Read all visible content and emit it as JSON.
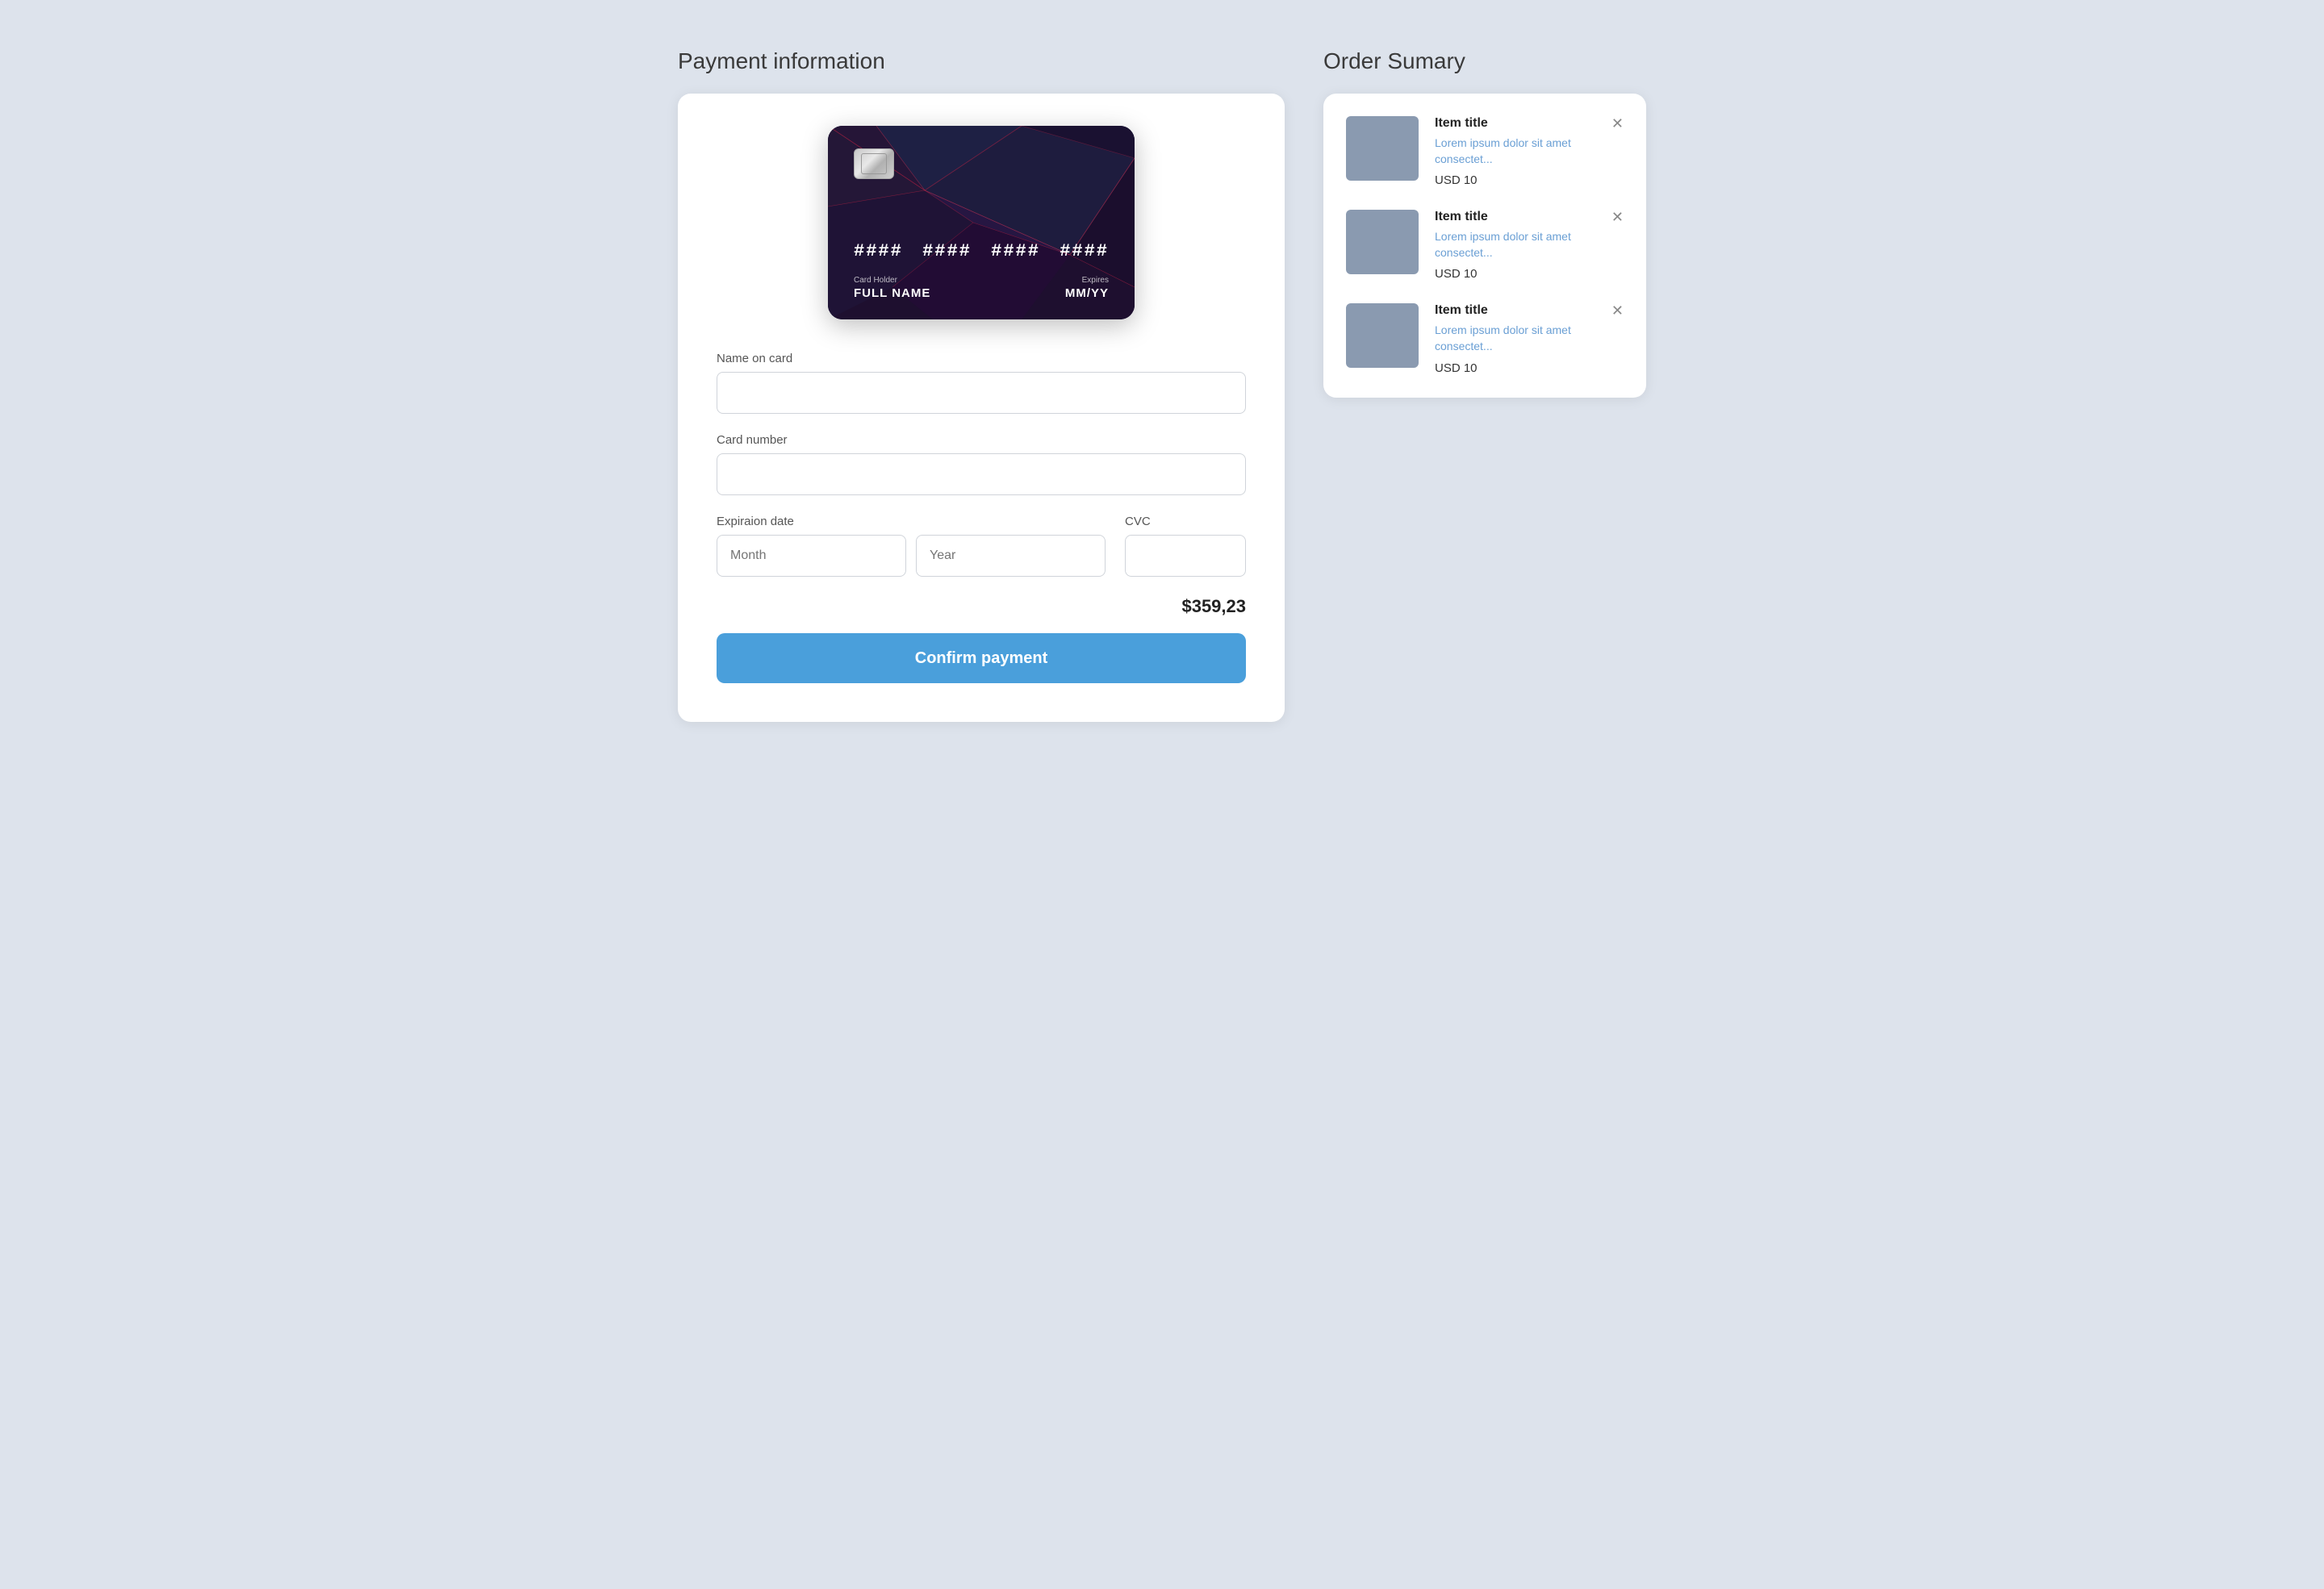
{
  "left": {
    "title": "Payment information",
    "card": {
      "number_groups": [
        "####",
        "####",
        "####",
        "####"
      ],
      "holder_label": "Card Holder",
      "holder_value": "FULL NAME",
      "expires_label": "Expires",
      "expires_value": "MM/YY"
    },
    "form": {
      "name_label": "Name on card",
      "name_placeholder": "",
      "card_number_label": "Card number",
      "card_number_placeholder": "",
      "expiry_label": "Expiraion date",
      "month_placeholder": "Month",
      "year_placeholder": "Year",
      "cvc_label": "CVC",
      "cvc_placeholder": ""
    },
    "total": "$359,23",
    "confirm_button": "Confirm payment"
  },
  "right": {
    "title": "Order Sumary",
    "items": [
      {
        "title": "Item title",
        "description": "Lorem ipsum dolor sit amet consectet...",
        "price": "USD 10"
      },
      {
        "title": "Item title",
        "description": "Lorem ipsum dolor sit amet consectet...",
        "price": "USD 10"
      },
      {
        "title": "Item title",
        "description": "Lorem ipsum dolor sit amet consectet...",
        "price": "USD 10"
      }
    ]
  }
}
